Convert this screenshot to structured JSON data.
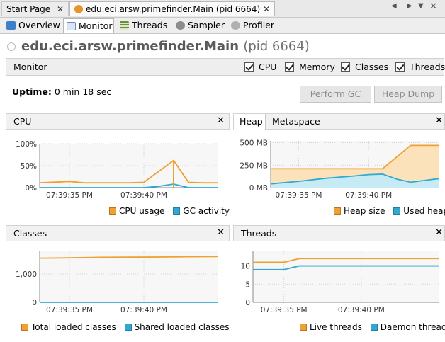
{
  "doc_tabs": {
    "start_page": "Start Page",
    "main_tab": "edu.eci.arsw.primefinder.Main (pid 6664)"
  },
  "view_tabs": [
    {
      "label": "Overview",
      "icon": "info-icon"
    },
    {
      "label": "Monitor",
      "icon": "monitor-icon"
    },
    {
      "label": "Threads",
      "icon": "threads-icon"
    },
    {
      "label": "Sampler",
      "icon": "sampler-icon"
    },
    {
      "label": "Profiler",
      "icon": "profiler-icon"
    }
  ],
  "header": {
    "title": "edu.eci.arsw.primefinder.Main",
    "pid": "(pid 6664)"
  },
  "monitor_bar": {
    "label": "Monitor",
    "checks": [
      "CPU",
      "Memory",
      "Classes",
      "Threads"
    ]
  },
  "uptime": {
    "label": "Uptime:",
    "value": "0 min 18 sec"
  },
  "buttons": {
    "perform_gc": "Perform GC",
    "heap_dump": "Heap Dump"
  },
  "colors": {
    "orange": "#f0a030",
    "blue": "#30a8d0",
    "accent": "#ff8800"
  },
  "panels": {
    "cpu": {
      "title": "CPU",
      "legend": [
        "CPU usage",
        "GC activity"
      ]
    },
    "heap": {
      "tabs": [
        "Heap",
        "Metaspace"
      ],
      "legend": [
        "Heap size",
        "Used heap"
      ]
    },
    "classes": {
      "title": "Classes",
      "legend": [
        "Total loaded classes",
        "Shared loaded classes"
      ]
    },
    "threads": {
      "title": "Threads",
      "legend": [
        "Live threads",
        "Daemon threads"
      ]
    }
  },
  "chart_data": [
    {
      "type": "line",
      "name": "cpu",
      "x": [
        "07:39:33",
        "07:39:35",
        "07:39:36",
        "07:39:37",
        "07:39:38",
        "07:39:39",
        "07:39:40",
        "07:39:41",
        "07:39:42",
        "07:39:43",
        "07:39:44",
        "07:39:45"
      ],
      "series": [
        {
          "name": "CPU usage",
          "values": [
            11,
            14,
            11,
            11,
            11,
            11,
            12,
            37,
            62,
            12,
            11,
            11
          ]
        },
        {
          "name": "GC activity",
          "values": [
            0,
            0,
            0,
            0,
            0,
            0,
            0,
            3,
            8,
            0,
            0,
            0
          ]
        }
      ],
      "x_ticks": [
        "07:39:35 PM",
        "07:39:40 PM"
      ],
      "y_ticks": [
        "0%",
        "50%",
        "100%"
      ],
      "ylim": [
        0,
        100
      ]
    },
    {
      "type": "area",
      "name": "heap",
      "x": [
        "07:39:33",
        "07:39:35",
        "07:39:37",
        "07:39:39",
        "07:39:40",
        "07:39:41",
        "07:39:42",
        "07:39:43",
        "07:39:44",
        "07:39:45"
      ],
      "series": [
        {
          "name": "Heap size",
          "values": [
            210,
            210,
            210,
            210,
            210,
            210,
            340,
            470,
            470,
            470
          ]
        },
        {
          "name": "Used heap",
          "values": [
            42,
            70,
            105,
            130,
            145,
            150,
            95,
            60,
            80,
            100
          ]
        }
      ],
      "x_ticks": [
        "07:39:35 PM",
        "07:39:40 PM"
      ],
      "y_ticks": [
        "0 MB",
        "250 MB",
        "500 MB"
      ],
      "ylim": [
        0,
        520
      ]
    },
    {
      "type": "line",
      "name": "classes",
      "x": [
        "07:39:33",
        "07:39:35",
        "07:39:37",
        "07:39:39",
        "07:39:41",
        "07:39:43",
        "07:39:45"
      ],
      "series": [
        {
          "name": "Total loaded classes",
          "values": [
            1560,
            1570,
            1590,
            1595,
            1600,
            1610,
            1615
          ]
        },
        {
          "name": "Shared loaded classes",
          "values": [
            0,
            0,
            0,
            0,
            0,
            0,
            0
          ]
        }
      ],
      "x_ticks": [
        "07:39:35 PM",
        "07:39:40 PM"
      ],
      "y_ticks": [
        "0",
        "1,000"
      ],
      "ylim": [
        0,
        1800
      ]
    },
    {
      "type": "line",
      "name": "threads",
      "x": [
        "07:39:33",
        "07:39:34",
        "07:39:35",
        "07:39:36",
        "07:39:40",
        "07:39:45"
      ],
      "series": [
        {
          "name": "Live threads",
          "values": [
            11,
            11,
            11,
            12,
            12,
            12
          ]
        },
        {
          "name": "Daemon threads",
          "values": [
            9,
            9,
            9,
            10,
            10,
            10
          ]
        }
      ],
      "x_ticks": [
        "07:39:35 PM",
        "07:39:40 PM"
      ],
      "y_ticks": [
        "0",
        "5",
        "10"
      ],
      "ylim": [
        0,
        14
      ]
    }
  ]
}
